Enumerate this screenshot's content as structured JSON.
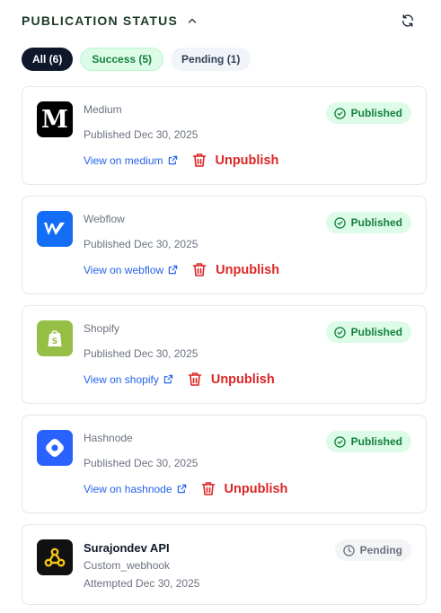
{
  "header": {
    "title": "PUBLICATION STATUS"
  },
  "filters": [
    {
      "label": "All (6)"
    },
    {
      "label": "Success (5)"
    },
    {
      "label": "Pending (1)"
    }
  ],
  "cards": [
    {
      "name": "Medium",
      "published": "Published Dec 30, 2025",
      "link": "View on medium",
      "action": "Unpublish",
      "status": "Published"
    },
    {
      "name": "Webflow",
      "published": "Published Dec 30, 2025",
      "link": "View on webflow",
      "action": "Unpublish",
      "status": "Published"
    },
    {
      "name": "Shopify",
      "published": "Published Dec 30, 2025",
      "link": "View on shopify",
      "action": "Unpublish",
      "status": "Published"
    },
    {
      "name": "Hashnode",
      "published": "Published Dec 30, 2025",
      "link": "View on hashnode",
      "action": "Unpublish",
      "status": "Published"
    },
    {
      "name": "Surajondev API",
      "type": "Custom_webhook",
      "attempted": "Attempted Dec 30, 2025",
      "status": "Pending"
    }
  ],
  "icons": {
    "collapse": "chevron-up-icon",
    "refresh": "refresh-icon",
    "external": "external-link-icon",
    "trash": "trash-icon",
    "published": "check-circle-icon",
    "pending": "clock-icon"
  },
  "colors": {
    "success": "#15803d",
    "success_bg": "#dcfce7",
    "danger": "#dc2626",
    "link": "#2563eb",
    "dark_chip": "#0f172a",
    "medium": "#000000",
    "webflow": "#146ef5",
    "shopify": "#95bf47",
    "hashnode": "#2962ff"
  }
}
